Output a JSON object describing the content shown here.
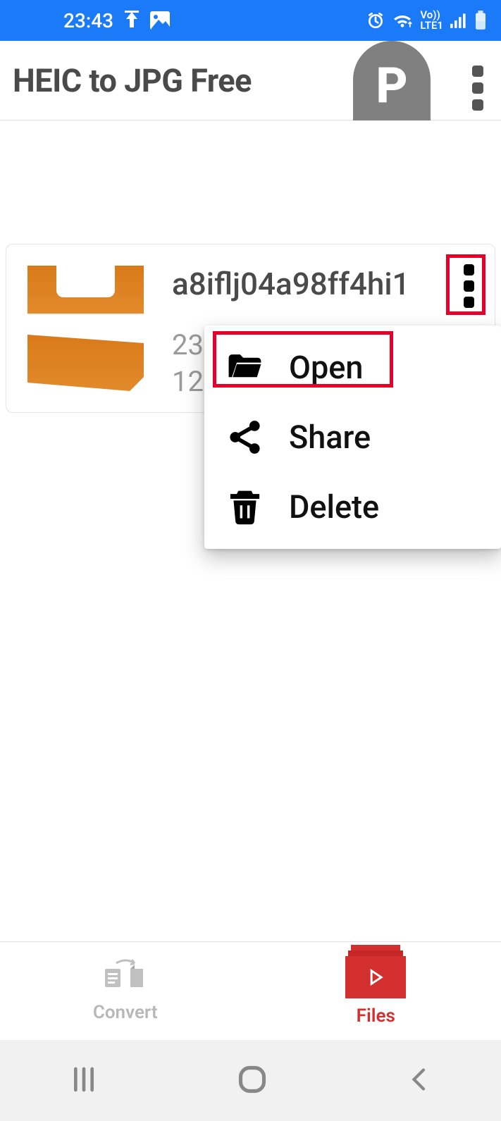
{
  "status": {
    "time": "23:43",
    "net_label": "Vo))\nLTE1"
  },
  "app": {
    "title": "HEIC to JPG Free"
  },
  "file": {
    "name": "a8iflj04a98ff4hi1",
    "meta_line1": "23",
    "meta_line2": "12"
  },
  "popup": {
    "open": "Open",
    "share": "Share",
    "delete": "Delete"
  },
  "bottom_nav": {
    "convert": "Convert",
    "files": "Files"
  }
}
